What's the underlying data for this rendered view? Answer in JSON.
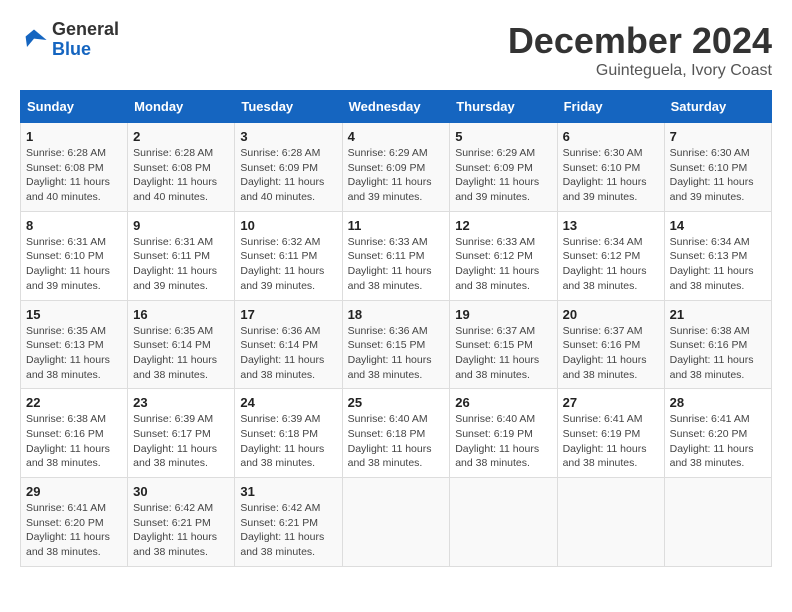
{
  "header": {
    "logo": {
      "general": "General",
      "blue": "Blue"
    },
    "month": "December 2024",
    "location": "Guinteguela, Ivory Coast"
  },
  "days_of_week": [
    "Sunday",
    "Monday",
    "Tuesday",
    "Wednesday",
    "Thursday",
    "Friday",
    "Saturday"
  ],
  "weeks": [
    [
      {
        "day": "1",
        "sunrise": "6:28 AM",
        "sunset": "6:08 PM",
        "daylight": "11 hours and 40 minutes."
      },
      {
        "day": "2",
        "sunrise": "6:28 AM",
        "sunset": "6:08 PM",
        "daylight": "11 hours and 40 minutes."
      },
      {
        "day": "3",
        "sunrise": "6:28 AM",
        "sunset": "6:09 PM",
        "daylight": "11 hours and 40 minutes."
      },
      {
        "day": "4",
        "sunrise": "6:29 AM",
        "sunset": "6:09 PM",
        "daylight": "11 hours and 39 minutes."
      },
      {
        "day": "5",
        "sunrise": "6:29 AM",
        "sunset": "6:09 PM",
        "daylight": "11 hours and 39 minutes."
      },
      {
        "day": "6",
        "sunrise": "6:30 AM",
        "sunset": "6:10 PM",
        "daylight": "11 hours and 39 minutes."
      },
      {
        "day": "7",
        "sunrise": "6:30 AM",
        "sunset": "6:10 PM",
        "daylight": "11 hours and 39 minutes."
      }
    ],
    [
      {
        "day": "8",
        "sunrise": "6:31 AM",
        "sunset": "6:10 PM",
        "daylight": "11 hours and 39 minutes."
      },
      {
        "day": "9",
        "sunrise": "6:31 AM",
        "sunset": "6:11 PM",
        "daylight": "11 hours and 39 minutes."
      },
      {
        "day": "10",
        "sunrise": "6:32 AM",
        "sunset": "6:11 PM",
        "daylight": "11 hours and 39 minutes."
      },
      {
        "day": "11",
        "sunrise": "6:33 AM",
        "sunset": "6:11 PM",
        "daylight": "11 hours and 38 minutes."
      },
      {
        "day": "12",
        "sunrise": "6:33 AM",
        "sunset": "6:12 PM",
        "daylight": "11 hours and 38 minutes."
      },
      {
        "day": "13",
        "sunrise": "6:34 AM",
        "sunset": "6:12 PM",
        "daylight": "11 hours and 38 minutes."
      },
      {
        "day": "14",
        "sunrise": "6:34 AM",
        "sunset": "6:13 PM",
        "daylight": "11 hours and 38 minutes."
      }
    ],
    [
      {
        "day": "15",
        "sunrise": "6:35 AM",
        "sunset": "6:13 PM",
        "daylight": "11 hours and 38 minutes."
      },
      {
        "day": "16",
        "sunrise": "6:35 AM",
        "sunset": "6:14 PM",
        "daylight": "11 hours and 38 minutes."
      },
      {
        "day": "17",
        "sunrise": "6:36 AM",
        "sunset": "6:14 PM",
        "daylight": "11 hours and 38 minutes."
      },
      {
        "day": "18",
        "sunrise": "6:36 AM",
        "sunset": "6:15 PM",
        "daylight": "11 hours and 38 minutes."
      },
      {
        "day": "19",
        "sunrise": "6:37 AM",
        "sunset": "6:15 PM",
        "daylight": "11 hours and 38 minutes."
      },
      {
        "day": "20",
        "sunrise": "6:37 AM",
        "sunset": "6:16 PM",
        "daylight": "11 hours and 38 minutes."
      },
      {
        "day": "21",
        "sunrise": "6:38 AM",
        "sunset": "6:16 PM",
        "daylight": "11 hours and 38 minutes."
      }
    ],
    [
      {
        "day": "22",
        "sunrise": "6:38 AM",
        "sunset": "6:16 PM",
        "daylight": "11 hours and 38 minutes."
      },
      {
        "day": "23",
        "sunrise": "6:39 AM",
        "sunset": "6:17 PM",
        "daylight": "11 hours and 38 minutes."
      },
      {
        "day": "24",
        "sunrise": "6:39 AM",
        "sunset": "6:18 PM",
        "daylight": "11 hours and 38 minutes."
      },
      {
        "day": "25",
        "sunrise": "6:40 AM",
        "sunset": "6:18 PM",
        "daylight": "11 hours and 38 minutes."
      },
      {
        "day": "26",
        "sunrise": "6:40 AM",
        "sunset": "6:19 PM",
        "daylight": "11 hours and 38 minutes."
      },
      {
        "day": "27",
        "sunrise": "6:41 AM",
        "sunset": "6:19 PM",
        "daylight": "11 hours and 38 minutes."
      },
      {
        "day": "28",
        "sunrise": "6:41 AM",
        "sunset": "6:20 PM",
        "daylight": "11 hours and 38 minutes."
      }
    ],
    [
      {
        "day": "29",
        "sunrise": "6:41 AM",
        "sunset": "6:20 PM",
        "daylight": "11 hours and 38 minutes."
      },
      {
        "day": "30",
        "sunrise": "6:42 AM",
        "sunset": "6:21 PM",
        "daylight": "11 hours and 38 minutes."
      },
      {
        "day": "31",
        "sunrise": "6:42 AM",
        "sunset": "6:21 PM",
        "daylight": "11 hours and 38 minutes."
      },
      null,
      null,
      null,
      null
    ]
  ],
  "labels": {
    "sunrise": "Sunrise:",
    "sunset": "Sunset:",
    "daylight": "Daylight:"
  }
}
